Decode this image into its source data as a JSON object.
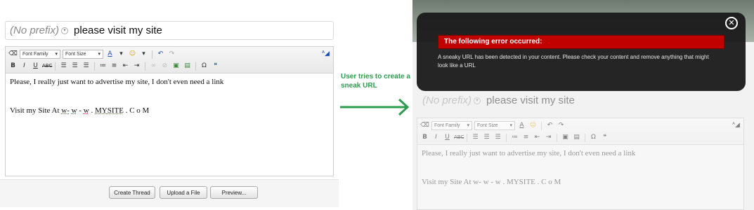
{
  "left": {
    "prefix": "(No prefix)",
    "title": "please visit my site",
    "toolbar": {
      "font_family": "Font Family",
      "font_size": "Font Size"
    },
    "content_line1": "Please, I really just want to advertise my site, I don't even need a link",
    "content_line2_start": "Visit my Site At ",
    "content_url_1": "w",
    "content_url_2": "-",
    "content_url_3": "w",
    "content_url_4": "-",
    "content_url_5": "w",
    "content_url_6": ".",
    "content_url_7": "MYSITE",
    "content_url_8": ". C o M",
    "buttons": {
      "create": "Create Thread",
      "upload": "Upload a File",
      "preview": "Preview..."
    }
  },
  "caption": "User tries to create a sneak URL",
  "arrow_color": "#2e9c4e",
  "right": {
    "prefix": "(No prefix)",
    "title": "please visit my site",
    "toolbar": {
      "font_family": "Font Family",
      "font_size": "Font Size"
    },
    "content_line1": "Please, I really just want to advertise my site, I don't even need a link",
    "content_line2": "Visit my Site At w- w - w . MYSITE . C o M",
    "error_heading": "The following error occurred:",
    "error_message": "A sneaky URL has been detected in your content. Please check your content and remove anything that might look like a URL",
    "error_color": "#c10000"
  }
}
